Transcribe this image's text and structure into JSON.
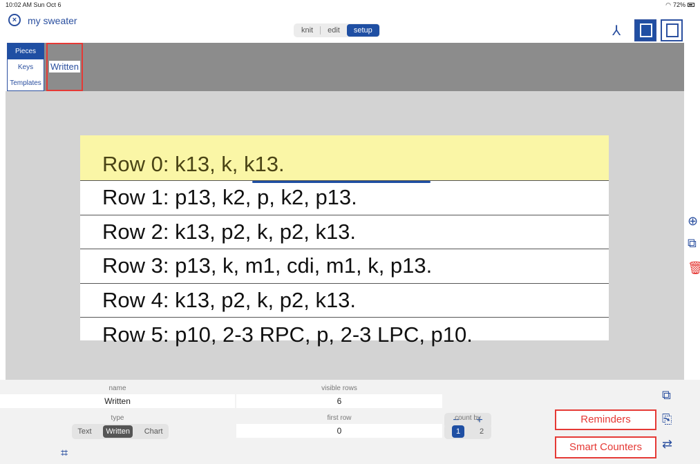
{
  "status": {
    "time": "10:02 AM  Sun Oct 6",
    "battery": "72%"
  },
  "header": {
    "close_icon": "x-circle-icon",
    "title": "my sweater",
    "modes": [
      "knit",
      "edit",
      "setup"
    ],
    "active_mode": "setup"
  },
  "sidebar": {
    "tabs": [
      "Pieces",
      "Keys",
      "Templates"
    ],
    "active": "Pieces"
  },
  "pieces": {
    "items": [
      "Written"
    ]
  },
  "written_rows": [
    "Row 0: k13, k, k13.",
    "Row 1: p13, k2, p, k2, p13.",
    "Row 2: k13, p2, k, p2, k13.",
    "Row 3: p13, k, m1, cdi, m1, k, p13.",
    "Row 4: k13, p2, k, p2, k13.",
    "Row 5: p10, 2-3 RPC, p, 2-3 LPC, p10."
  ],
  "settings": {
    "name_label": "name",
    "name_value": "Written",
    "visible_rows_label": "visible rows",
    "visible_rows_value": "6",
    "type_label": "type",
    "type_options": [
      "Text",
      "Written",
      "Chart"
    ],
    "first_row_label": "first row",
    "first_row_value": "0",
    "count_by_label": "count by",
    "count_by_options": [
      "1",
      "2"
    ]
  },
  "buttons": {
    "reminders": "Reminders",
    "smart_counters": "Smart Counters"
  },
  "colors": {
    "accent": "#1f4fa3",
    "highlight": "#faf6a6",
    "red": "#e53935"
  }
}
